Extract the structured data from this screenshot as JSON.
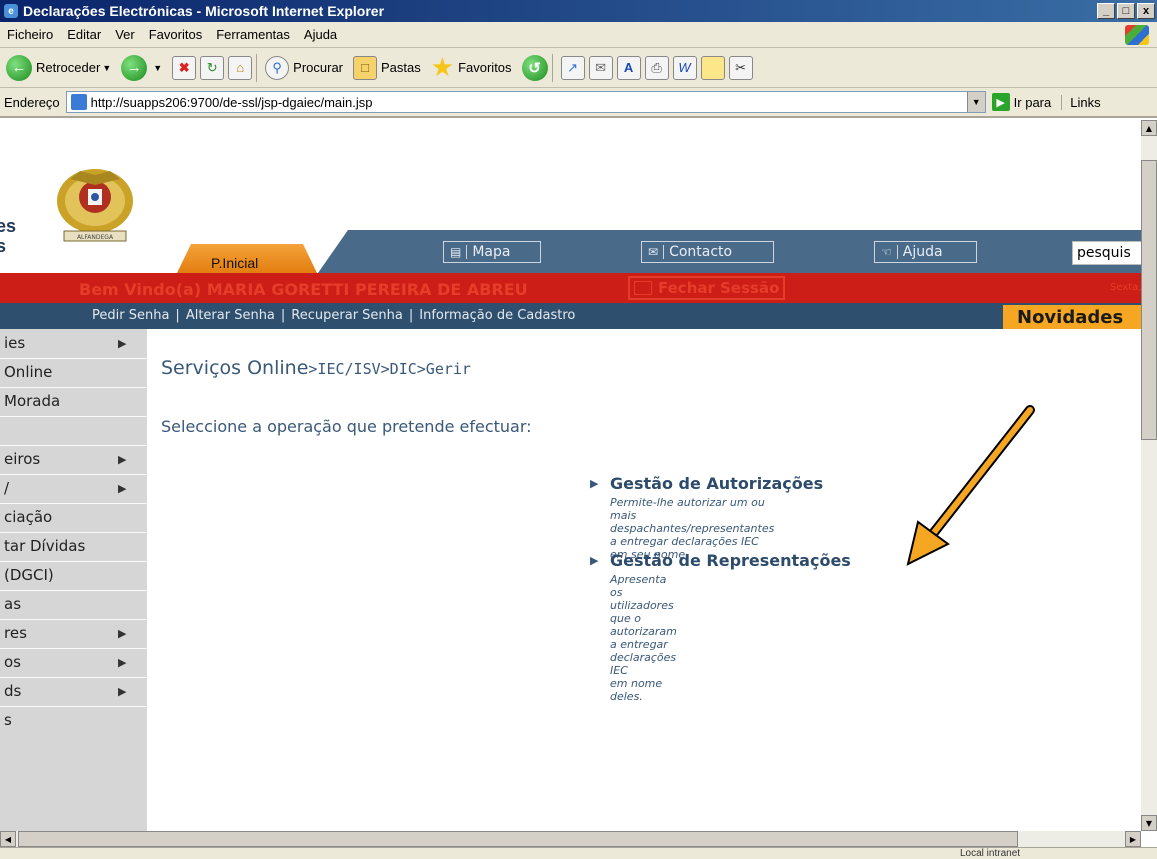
{
  "window": {
    "title": "Declarações Electrónicas - Microsoft Internet Explorer",
    "controls": [
      "_",
      "□",
      "x"
    ]
  },
  "menu": [
    "Ficheiro",
    "Editar",
    "Ver",
    "Favoritos",
    "Ferramentas",
    "Ajuda"
  ],
  "toolbar": {
    "back": "Retroceder",
    "search": "Procurar",
    "folders": "Pastas",
    "favorites": "Favoritos"
  },
  "address": {
    "label": "Endereço",
    "url": "http://suapps206:9700/de-ssl/jsp-dgaiec/main.jsp",
    "go": "Ir para",
    "links": "Links"
  },
  "site": {
    "side_text_1": "es",
    "side_text_2": "s",
    "crest_label": "ALFANDEGA",
    "tab_home": "P.Inicial",
    "nav": [
      "Mapa",
      "Contacto",
      "Ajuda"
    ],
    "search_value": "pesquis",
    "welcome": "Bem Vindo(a) MARIA GORETTI PEREIRA DE ABREU",
    "logout": "Fechar Sessão",
    "date": "Sexta,",
    "subnav": [
      "Pedir Senha",
      "Alterar Senha",
      "Recuperar Senha",
      "Informação de Cadastro"
    ],
    "novidades": "Novidades"
  },
  "sidebar": [
    {
      "label": "ies",
      "arrow": true
    },
    {
      "label": "Online",
      "arrow": false
    },
    {
      "label": "Morada",
      "arrow": false
    },
    {
      "label": "",
      "arrow": false
    },
    {
      "label": "eiros",
      "arrow": true
    },
    {
      "label": "/",
      "arrow": true
    },
    {
      "label": "ciação",
      "arrow": false
    },
    {
      "label": "tar Dívidas",
      "arrow": false
    },
    {
      "label": "(DGCI)",
      "arrow": false
    },
    {
      "label": "as",
      "arrow": false
    },
    {
      "label": "res",
      "arrow": true
    },
    {
      "label": "os",
      "arrow": true
    },
    {
      "label": "ds",
      "arrow": true
    },
    {
      "label": "s",
      "arrow": false
    }
  ],
  "main": {
    "breadcrumb_root": "Serviços Online",
    "breadcrumb_rest": "IEC/ISV>DIC>Gerir",
    "gt": ">",
    "instruction": "Seleccione a operação que pretende efectuar:",
    "operations": [
      {
        "title": "Gestão de Autorizações",
        "desc_1": "Permite-lhe autorizar um ou mais despachantes/representantes",
        "desc_2": "a entregar declarações IEC em seu nome."
      },
      {
        "title": "Gestão de Representações",
        "desc_1": "Apresenta os utilizadores que o autorizaram a entregar declarações IEC",
        "desc_2": "em nome deles."
      }
    ]
  },
  "status": {
    "zone": "Local intranet"
  },
  "colors": {
    "title_bar": "#0a246a",
    "nav_band": "#4a6a8a",
    "welcome_bar": "#cc1e16",
    "subnav_bar": "#2f4f6f",
    "novidades": "#f5a623",
    "tab_home": "#f4a33a",
    "annotation_arrow": "#f5a623"
  }
}
